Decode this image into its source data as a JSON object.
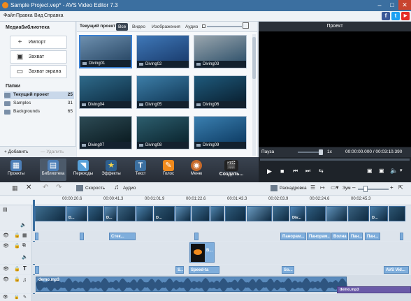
{
  "window": {
    "title": "Sample Project.vep* - AVS Video Editor 7.3"
  },
  "menu": [
    "Файл",
    "Правка",
    "Вид",
    "Справка"
  ],
  "social": [
    {
      "name": "facebook-icon",
      "glyph": "f",
      "color": "#3b5998"
    },
    {
      "name": "twitter-icon",
      "glyph": "t",
      "color": "#1da1f2"
    },
    {
      "name": "youtube-icon",
      "glyph": "▶",
      "color": "#e52d27"
    }
  ],
  "library": {
    "title": "Медиабиблиотека",
    "import_label": "Импорт",
    "capture_label": "Захват",
    "screen_capture_label": "Захват экрана",
    "folders_title": "Папки",
    "folders": [
      {
        "label": "Текущий проект",
        "count": "25"
      },
      {
        "label": "Samples",
        "count": "31"
      },
      {
        "label": "Backgrounds",
        "count": "65"
      }
    ],
    "add_label": "Добавить",
    "delete_label": "Удалить"
  },
  "browser": {
    "current_label": "Текущий проект",
    "filters": [
      "Все",
      "Видео",
      "Изображения",
      "Аудио"
    ],
    "thumbs": [
      "Diving01",
      "Diving02",
      "Diving03",
      "Diving04",
      "Diving05",
      "Diving06",
      "Diving07",
      "Diving08",
      "Diving09"
    ]
  },
  "preview": {
    "title": "Проект",
    "status": "Пауза",
    "speed": "1x",
    "time": "00:00:00.000 / 00:03:10.390"
  },
  "toolbar": [
    "Проекты",
    "Библиотека",
    "Переходы",
    "Эффекты",
    "Текст",
    "Голос",
    "Меню",
    "Создать..."
  ],
  "timeline_tools": {
    "speed_label": "Скорость",
    "audio_label": "Аудио",
    "storyboard_label": "Раскадровка",
    "zoom_label": "Зум"
  },
  "ruler": [
    "00:00:20.6",
    "00:00:41.3",
    "00:01:01.9",
    "00:01:22.6",
    "00:01:43.3",
    "00:02:03.9",
    "00:02:24.6",
    "00:02:45.3"
  ],
  "effects_track": [
    "Стек...",
    "Панорам...",
    "Панорам...",
    "Волна",
    "Пан...",
    "Пан..."
  ],
  "overlay_track": [
    "В..."
  ],
  "text_track": [
    "S...",
    "Speed-ta",
    "So...",
    "AVS Vid..."
  ],
  "audio_track": {
    "label": "demo.mp3",
    "label2": "demo.mp3"
  },
  "video_clip_labels": [
    "D...",
    "D...",
    "D...",
    "Div...",
    "D..."
  ]
}
